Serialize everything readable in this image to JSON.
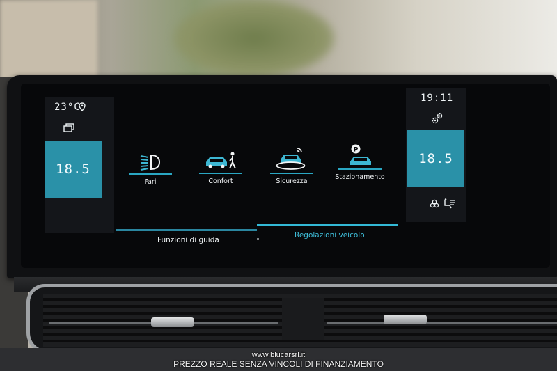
{
  "status": {
    "outside_temp": "23°C",
    "clock": "19:11"
  },
  "climate": {
    "left_temp": "18.5",
    "right_temp": "18.5"
  },
  "menu": {
    "items": [
      {
        "label": "Fari",
        "icon": "headlight-icon"
      },
      {
        "label": "Confort",
        "icon": "car-comfort-icon"
      },
      {
        "label": "Sicurezza",
        "icon": "car-safety-icon"
      },
      {
        "label": "Stazionamento",
        "icon": "parking-car-icon"
      }
    ]
  },
  "tabs": [
    {
      "label": "Funzioni di guida",
      "active": false
    },
    {
      "label": "Regolazioni veicolo",
      "active": true
    }
  ],
  "colors": {
    "accent": "#2aa7c3",
    "temp_box": "#2a91a8",
    "screen_bg": "#07080a"
  },
  "watermark": {
    "url": "www.blucarsrl.it",
    "text": "PREZZO REALE SENZA VINCOLI DI FINANZIAMENTO"
  }
}
